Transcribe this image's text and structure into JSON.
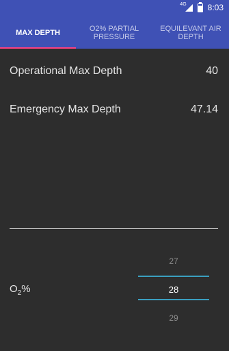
{
  "status_bar": {
    "network": "4G",
    "time": "8:03"
  },
  "tabs": [
    {
      "label": "MAX DEPTH",
      "active": true
    },
    {
      "label": "O2% PARTIAL PRESSURE",
      "active": false
    },
    {
      "label": "EQUILEVANT AIR DEPTH",
      "active": false
    }
  ],
  "results": {
    "operational": {
      "label": "Operational Max Depth",
      "value": "40"
    },
    "emergency": {
      "label": "Emergency Max Depth",
      "value": "47.14"
    }
  },
  "o2_input": {
    "label_main": "O",
    "label_sub": "2",
    "label_suffix": "%",
    "picker": {
      "prev": "27",
      "selected": "28",
      "next": "29"
    }
  },
  "colors": {
    "app_bar": "#3f51b5",
    "tab_indicator": "#ff4081",
    "background": "#2d2d2d",
    "picker_divider": "#3a9fc0"
  }
}
